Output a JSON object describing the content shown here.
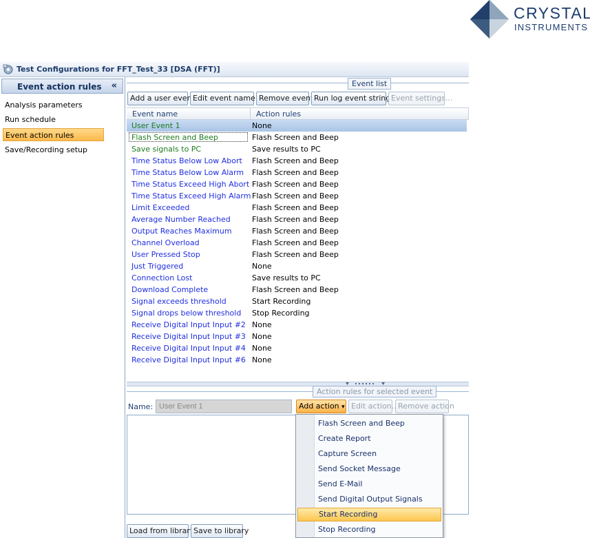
{
  "logo": {
    "line1": "CRYSTAL",
    "line2": "INSTRUMENTS"
  },
  "window": {
    "title": "Test Configurations for FFT_Test_33 [DSA (FFT)]"
  },
  "nav": {
    "header": "Event action rules",
    "collapse": "«",
    "items": [
      {
        "label": "Analysis parameters"
      },
      {
        "label": "Run schedule"
      },
      {
        "label": "Event action rules"
      },
      {
        "label": "Save/Recording setup"
      }
    ]
  },
  "event_list": {
    "group_label": "Event list",
    "buttons": {
      "add": "Add a user event",
      "edit_name": "Edit event name...",
      "remove": "Remove event",
      "run_log": "Run log event strings",
      "settings": "Event settings..."
    },
    "columns": {
      "name": "Event name",
      "action": "Action rules"
    },
    "rows": [
      {
        "name": "User Event 1",
        "action": "None"
      },
      {
        "name": "Flash Screen and Beep",
        "action": "Flash Screen and Beep"
      },
      {
        "name": "Save signals to PC",
        "action": "Save results to PC"
      },
      {
        "name": "Time Status Below Low Abort",
        "action": "Flash Screen and Beep"
      },
      {
        "name": "Time Status Below Low Alarm",
        "action": "Flash Screen and Beep"
      },
      {
        "name": "Time Status Exceed High Abort",
        "action": "Flash Screen and Beep"
      },
      {
        "name": "Time Status Exceed High Alarm",
        "action": "Flash Screen and Beep"
      },
      {
        "name": "Limit Exceeded",
        "action": "Flash Screen and Beep"
      },
      {
        "name": "Average Number Reached",
        "action": "Flash Screen and Beep"
      },
      {
        "name": "Output Reaches Maximum",
        "action": "Flash Screen and Beep"
      },
      {
        "name": "Channel Overload",
        "action": "Flash Screen and Beep"
      },
      {
        "name": "User Pressed Stop",
        "action": "Flash Screen and Beep"
      },
      {
        "name": "Just Triggered",
        "action": "None"
      },
      {
        "name": "Connection Lost",
        "action": "Save results to PC"
      },
      {
        "name": "Download Complete",
        "action": "Flash Screen and Beep"
      },
      {
        "name": "Signal exceeds threshold",
        "action": "Start Recording"
      },
      {
        "name": "Signal drops below threshold",
        "action": "Stop Recording"
      },
      {
        "name": "Receive Digital Input Input  #2",
        "action": "None"
      },
      {
        "name": "Receive Digital Input Input  #3",
        "action": "None"
      },
      {
        "name": "Receive Digital Input Input  #4",
        "action": "None"
      },
      {
        "name": "Receive Digital Input Input  #6",
        "action": "None"
      }
    ]
  },
  "action_rules": {
    "group_label": "Action rules for selected event",
    "name_label": "Name:",
    "name_value": "User Event 1",
    "buttons": {
      "add_action": "Add action",
      "add_action_arrow": "▾",
      "edit_action": "Edit action...",
      "remove_action": "Remove action"
    }
  },
  "dropdown": {
    "items": [
      {
        "label": "Flash Screen and Beep"
      },
      {
        "label": "Create Report"
      },
      {
        "label": "Capture Screen"
      },
      {
        "label": "Send Socket Message"
      },
      {
        "label": "Send E-Mail"
      },
      {
        "label": "Send Digital Output Signals"
      },
      {
        "label": "Start Recording"
      },
      {
        "label": "Stop Recording"
      }
    ],
    "highlighted": "Start Recording"
  },
  "library": {
    "load": "Load from library",
    "save": "Save to library"
  },
  "colors": {
    "brand": "#1d3d6c",
    "selection_orange": "#fbb94b",
    "event_name_blue": "#1f2ee0",
    "event_name_green": "#1d7a1d",
    "row_selected": "#a9c4e6"
  }
}
